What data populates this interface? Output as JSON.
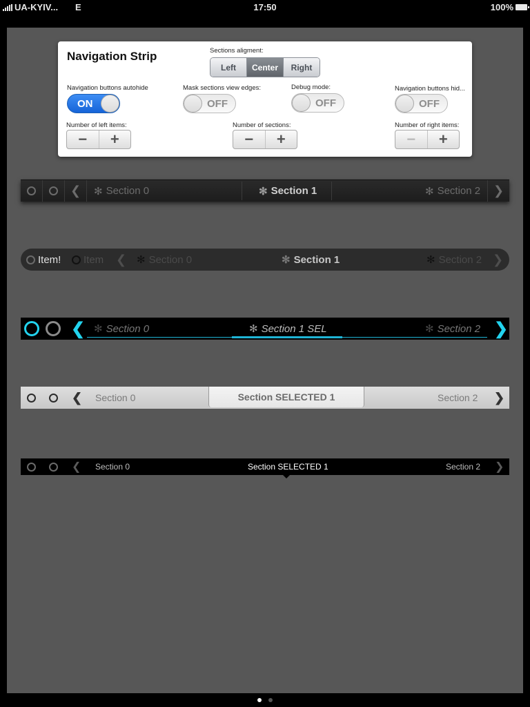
{
  "status_bar": {
    "carrier": "UA-KYIV...",
    "network": "E",
    "time": "17:50",
    "battery": "100%"
  },
  "panel": {
    "title": "Navigation Strip",
    "alignment": {
      "label": "Sections aligment:",
      "options": [
        "Left",
        "Center",
        "Right"
      ],
      "selected": "Center"
    },
    "switches": [
      {
        "label": "Navigation buttons autohide",
        "state": "ON"
      },
      {
        "label": "Mask sections view edges:",
        "state": "OFF"
      },
      {
        "label": "Debug mode:",
        "state": "OFF"
      },
      {
        "label": "Navigation buttons hid...",
        "state": "OFF"
      }
    ],
    "steppers": [
      {
        "label": "Number of left items:",
        "minus": "−",
        "plus": "+"
      },
      {
        "label": "Number of sections:",
        "minus": "−",
        "plus": "+"
      },
      {
        "label": "Number of right items:",
        "minus": "−",
        "plus": "+"
      }
    ]
  },
  "strips": {
    "strip1": {
      "left_icons": [
        "circle-icon",
        "circle-icon"
      ],
      "prev": "❮",
      "next": "❯",
      "asterisk": "✻",
      "sections": [
        "Section 0",
        "Section 1",
        "Section 2"
      ],
      "selected_index": 1
    },
    "strip2": {
      "items": [
        "Item!",
        "Item"
      ],
      "prev": "❮",
      "next": "❯",
      "asterisk": "✻",
      "sections": [
        "Section 0",
        "Section 1",
        "Section 2"
      ],
      "selected_index": 1
    },
    "strip3": {
      "prev": "❮",
      "next": "❯",
      "asterisk": "✻",
      "sections": [
        "Section 0",
        "Section 1 SEL",
        "Section 2"
      ],
      "selected_index": 1,
      "accent": "#1fb5d6"
    },
    "strip4": {
      "prev": "❮",
      "next": "❯",
      "sections": [
        "Section 0",
        "Section SELECTED 1",
        "Section 2"
      ],
      "selected_index": 1
    },
    "strip5": {
      "prev": "❮",
      "next": "❯",
      "sections": [
        "Section 0",
        "Section SELECTED 1",
        "Section 2"
      ],
      "selected_index": 1
    }
  },
  "pager": {
    "pages": 2,
    "current": 1
  }
}
